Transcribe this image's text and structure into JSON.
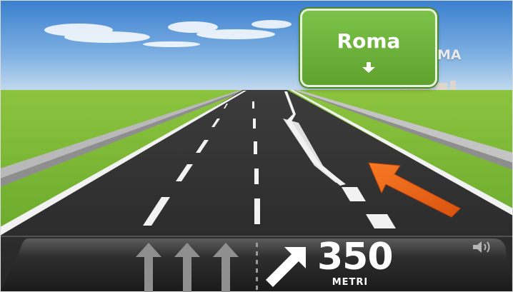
{
  "guidance": {
    "sign_destination": "Roma",
    "background_city_text": "MA",
    "distance_value": "350",
    "distance_unit": "METRI",
    "lane_arrows": [
      "straight-arrow-icon",
      "straight-arrow-icon",
      "straight-arrow-icon"
    ],
    "maneuver_icon": "bear-right-arrow-icon",
    "volume_icon": "speaker-icon"
  },
  "colors": {
    "sign_green": "#6bb33a",
    "highway_arrow": "#ee6a1c",
    "grass": "#73b62d",
    "asphalt": "#2f2f2f"
  }
}
